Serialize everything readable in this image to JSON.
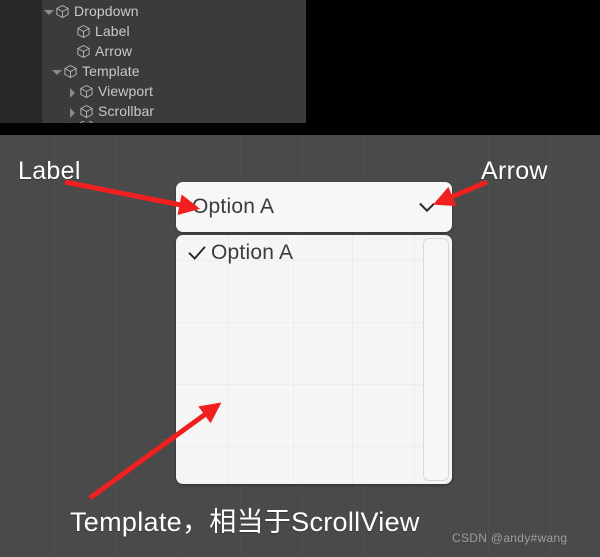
{
  "hierarchy": {
    "rows": [
      {
        "label": "Dropdown",
        "indent": 0,
        "foldout": "down",
        "icon": "cube-icon"
      },
      {
        "label": "Label",
        "indent": 1,
        "foldout": "none",
        "icon": "cube-icon"
      },
      {
        "label": "Arrow",
        "indent": 1,
        "foldout": "none",
        "icon": "cube-icon"
      },
      {
        "label": "Template",
        "indent": 1,
        "foldout": "down",
        "icon": "cube-icon"
      },
      {
        "label": "Viewport",
        "indent": 2,
        "foldout": "right",
        "icon": "cube-icon"
      },
      {
        "label": "Scrollbar",
        "indent": 2,
        "foldout": "right",
        "icon": "cube-icon"
      }
    ]
  },
  "dropdown": {
    "selected_value": "Option A",
    "arrow_icon": "chevron-down-icon",
    "options": [
      {
        "label": "Option A",
        "checked": true,
        "check_icon": "checkmark-icon"
      }
    ]
  },
  "annotations": {
    "label": "Label",
    "arrow": "Arrow",
    "bottom": "Template，相当于ScrollView"
  },
  "watermark": "CSDN @andy#wang",
  "colors": {
    "panel_bg": "#3b3b3b",
    "panel_gutter": "#282828",
    "gameview_bg": "#4a4a4a",
    "widget_bg": "#f7f7f7",
    "annotation_arrow": "#f02020",
    "text_light": "#c9c9c9",
    "text_dark": "#3b3b3b"
  }
}
